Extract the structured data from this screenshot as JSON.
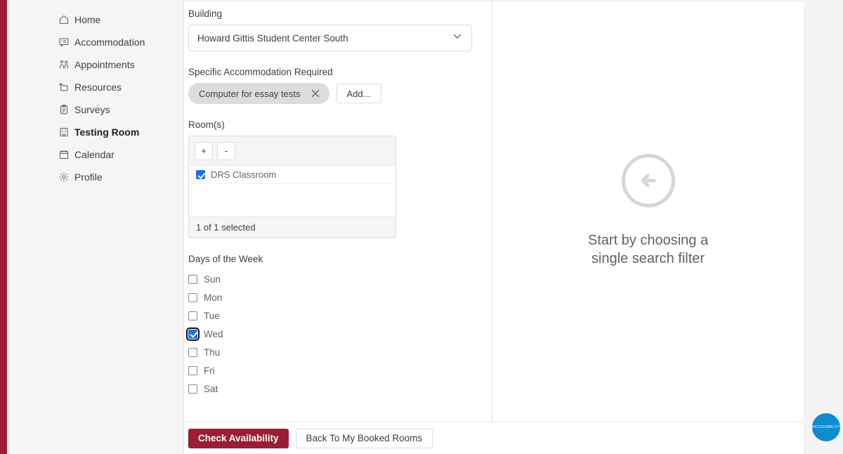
{
  "theme": {
    "brand_color": "#9c1c36",
    "accent_checkbox": "#1a73e8",
    "widget_color": "#0f8ccd"
  },
  "sidebar": {
    "items": [
      {
        "label": "Home",
        "icon": "home-icon",
        "active": false
      },
      {
        "label": "Accommodation",
        "icon": "message-list-icon",
        "active": false
      },
      {
        "label": "Appointments",
        "icon": "people-icon",
        "active": false
      },
      {
        "label": "Resources",
        "icon": "folder-icon",
        "active": false
      },
      {
        "label": "Surveys",
        "icon": "clipboard-icon",
        "active": false
      },
      {
        "label": "Testing Room",
        "icon": "building-icon",
        "active": true
      },
      {
        "label": "Calendar",
        "icon": "calendar-icon",
        "active": false
      },
      {
        "label": "Profile",
        "icon": "gear-icon",
        "active": false
      }
    ]
  },
  "form": {
    "building": {
      "label": "Building",
      "value": "Howard Gittis Student Center South"
    },
    "accommodation": {
      "label": "Specific Accommodation Required",
      "chip": "Computer for essay tests",
      "add_label": "Add..."
    },
    "rooms": {
      "label": "Room(s)",
      "add_button": "+",
      "remove_button": "-",
      "items": [
        {
          "label": "DRS Classroom",
          "checked": true
        }
      ],
      "status": "1 of 1 selected"
    },
    "days": {
      "label": "Days of the Week",
      "items": [
        {
          "label": "Sun",
          "checked": false,
          "focused": false
        },
        {
          "label": "Mon",
          "checked": false,
          "focused": false
        },
        {
          "label": "Tue",
          "checked": false,
          "focused": false
        },
        {
          "label": "Wed",
          "checked": true,
          "focused": true
        },
        {
          "label": "Thu",
          "checked": false,
          "focused": false
        },
        {
          "label": "Fri",
          "checked": false,
          "focused": false
        },
        {
          "label": "Sat",
          "checked": false,
          "focused": false
        }
      ]
    }
  },
  "empty_state": {
    "icon": "arrow-left-circle-icon",
    "line1": "Start by choosing a",
    "line2": "single search filter"
  },
  "footer": {
    "primary_label": "Check Availability",
    "secondary_label": "Back To My Booked Rooms"
  },
  "widget": {
    "label": "ACCESSIBILITY",
    "icon": "accessibility-widget-icon"
  }
}
